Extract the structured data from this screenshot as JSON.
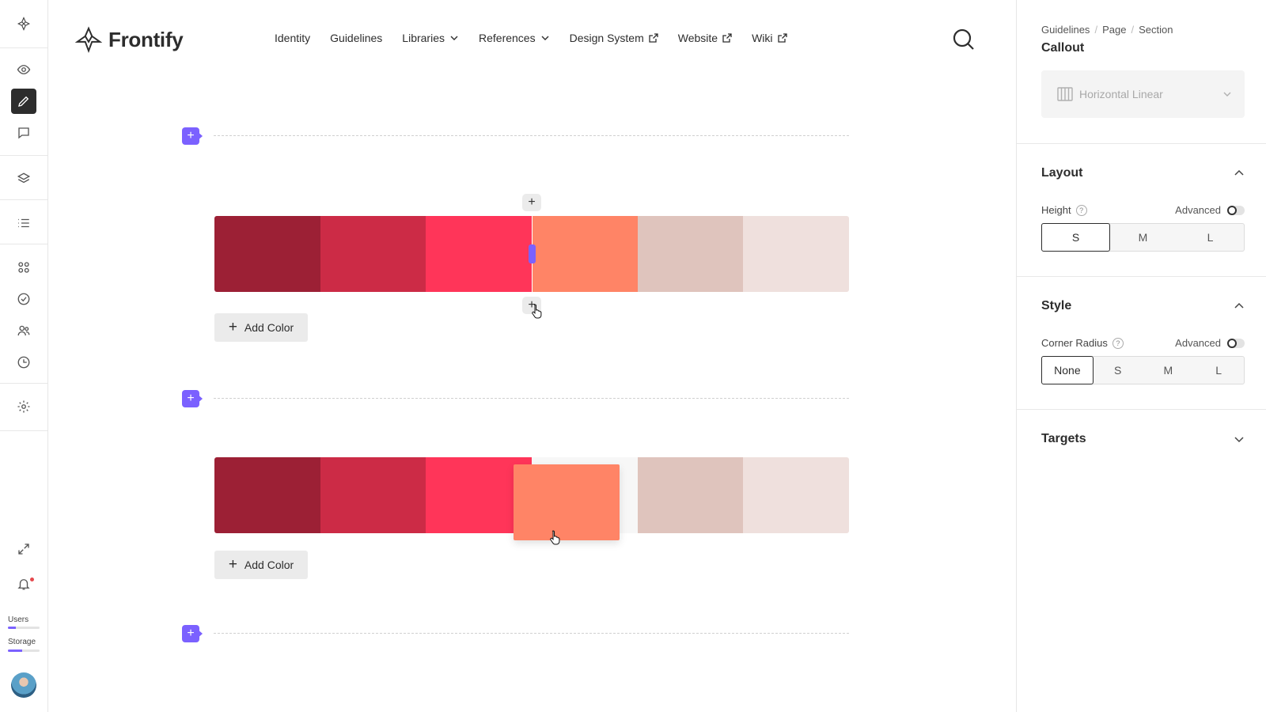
{
  "brand": {
    "name": "Frontify"
  },
  "nav": {
    "items": [
      {
        "label": "Identity",
        "icon": ""
      },
      {
        "label": "Guidelines",
        "icon": ""
      },
      {
        "label": "Libraries",
        "icon": "chevron-down-icon"
      },
      {
        "label": "References",
        "icon": "chevron-down-icon"
      },
      {
        "label": "Design System",
        "icon": "external-link-icon"
      },
      {
        "label": "Website",
        "icon": "external-link-icon"
      },
      {
        "label": "Wiki",
        "icon": "external-link-icon"
      }
    ]
  },
  "sidebar": {
    "icons": [
      "frontify-mark-icon",
      "eye-icon",
      "pencil-icon",
      "comment-icon",
      "layers-icon",
      "list-icon",
      "grid-icon",
      "check-circle-icon",
      "users-icon",
      "clock-icon",
      "gear-icon",
      "expand-icon",
      "bell-icon"
    ],
    "active": "pencil-icon",
    "usage": [
      {
        "label": "Users",
        "fraction": 0.25
      },
      {
        "label": "Storage",
        "fraction": 0.45
      }
    ]
  },
  "canvas": {
    "add_block_symbol": "+",
    "insert_symbol": "+",
    "palettes": [
      {
        "colors": [
          "#9c2035",
          "#cc2b46",
          "#ff3559",
          "#ff8466",
          "#dfc4bd",
          "#efe0dd"
        ],
        "add_label": "Add Color"
      },
      {
        "colors": [
          "#9c2035",
          "#cc2b46",
          "#ff3559",
          "#f7f7f7",
          "#dfc4bd",
          "#efe0dd"
        ],
        "add_label": "Add Color",
        "dragging_color": "#ff8466"
      }
    ]
  },
  "panel": {
    "breadcrumb": [
      "Guidelines",
      "Page",
      "Section"
    ],
    "title": "Callout",
    "variant": {
      "label": "Horizontal Linear",
      "icon": "columns-icon"
    },
    "layout": {
      "heading": "Layout",
      "height_label": "Height",
      "advanced_label": "Advanced",
      "options": [
        "S",
        "M",
        "L"
      ],
      "selected": "S"
    },
    "style": {
      "heading": "Style",
      "radius_label": "Corner Radius",
      "advanced_label": "Advanced",
      "options": [
        "None",
        "S",
        "M",
        "L"
      ],
      "selected": "None"
    },
    "targets": {
      "heading": "Targets"
    }
  },
  "colors": {
    "accent": "#7b61ff",
    "text": "#2d2d2d",
    "border": "#e6e6e6"
  }
}
